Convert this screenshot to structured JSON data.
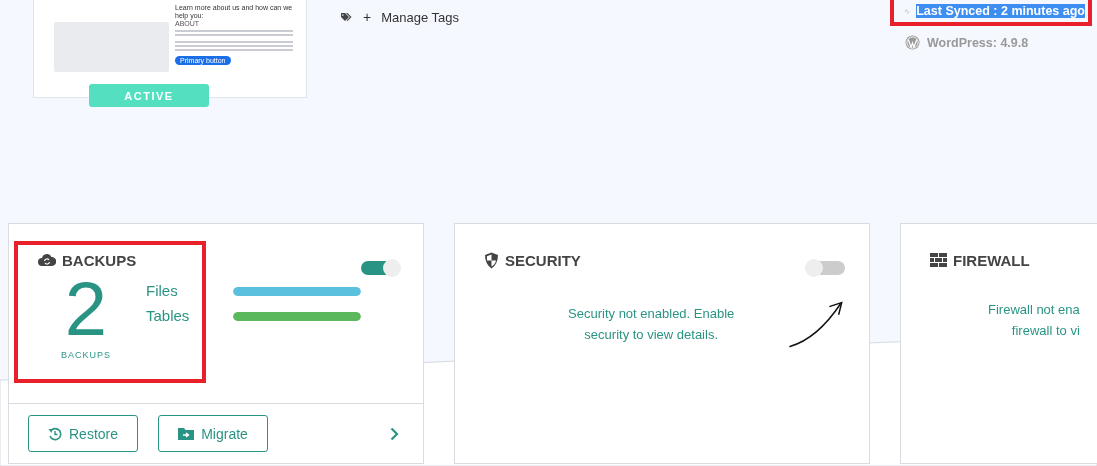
{
  "site_preview": {
    "heading": "Learn more about us and how can we help you:",
    "label": "ABOUT",
    "button": "Primary button",
    "status": "ACTIVE"
  },
  "tags": {
    "add_symbol": "+",
    "action": "Manage Tags"
  },
  "sync": {
    "text": "Last Synced : 2 minutes ago",
    "highlighted": true,
    "annotated": true
  },
  "wordpress": {
    "text": "WordPress: 4.9.8"
  },
  "cards": [
    {
      "kind": "backups",
      "title": "BACKUPS",
      "enabled": true,
      "annotated": true,
      "count": "2",
      "count_label": "BACKUPS",
      "legend": [
        {
          "label": "Files",
          "color": "#5bc0de"
        },
        {
          "label": "Tables",
          "color": "#5cb85c"
        }
      ],
      "actions": [
        {
          "kind": "restore",
          "label": "Restore"
        },
        {
          "kind": "migrate",
          "label": "Migrate"
        }
      ]
    },
    {
      "kind": "security",
      "title": "SECURITY",
      "enabled": false,
      "annotated": false,
      "message": [
        "Security not enabled. Enable",
        "security to view details."
      ]
    },
    {
      "kind": "firewall",
      "title": "FIREWALL",
      "annotated": false,
      "message": [
        "Firewall not ena",
        "firewall to vi"
      ]
    }
  ]
}
